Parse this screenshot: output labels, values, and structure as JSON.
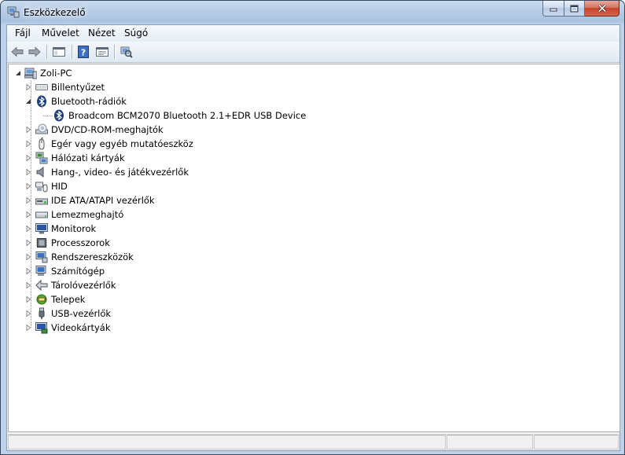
{
  "window": {
    "title": "Eszközkezelő",
    "icon": "device-manager-icon"
  },
  "menu": [
    {
      "label": "Fájl"
    },
    {
      "label": "Művelet"
    },
    {
      "label": "Nézet"
    },
    {
      "label": "Súgó"
    }
  ],
  "toolbar": [
    {
      "name": "back-icon"
    },
    {
      "name": "forward-icon"
    },
    {
      "name": "show-hide-console-tree-icon"
    },
    {
      "name": "help-icon"
    },
    {
      "name": "properties-icon"
    },
    {
      "name": "scan-hardware-icon"
    }
  ],
  "tree": {
    "root": {
      "label": "Zoli-PC",
      "icon": "computer-icon",
      "expanded": true
    },
    "nodes": [
      {
        "label": "Billentyűzet",
        "icon": "keyboard-icon",
        "expanded": false
      },
      {
        "label": "Bluetooth-rádiók",
        "icon": "bluetooth-icon",
        "expanded": true,
        "children": [
          {
            "label": "Broadcom BCM2070 Bluetooth 2.1+EDR USB Device",
            "icon": "bluetooth-device-icon"
          }
        ]
      },
      {
        "label": "DVD/CD-ROM-meghajtók",
        "icon": "dvd-drive-icon",
        "expanded": false
      },
      {
        "label": "Egér vagy egyéb mutatóeszköz",
        "icon": "mouse-icon",
        "expanded": false
      },
      {
        "label": "Hálózati kártyák",
        "icon": "network-adapter-icon",
        "expanded": false
      },
      {
        "label": "Hang-, video- és játékvezérlők",
        "icon": "sound-icon",
        "expanded": false
      },
      {
        "label": "HID",
        "icon": "hid-icon",
        "expanded": false
      },
      {
        "label": "IDE ATA/ATAPI vezérlők",
        "icon": "ide-controller-icon",
        "expanded": false
      },
      {
        "label": "Lemezmeghajtó",
        "icon": "disk-drive-icon",
        "expanded": false
      },
      {
        "label": "Monitorok",
        "icon": "monitor-icon",
        "expanded": false
      },
      {
        "label": "Processzorok",
        "icon": "processor-icon",
        "expanded": false
      },
      {
        "label": "Rendszereszközök",
        "icon": "system-devices-icon",
        "expanded": false
      },
      {
        "label": "Számítógép",
        "icon": "computer-category-icon",
        "expanded": false
      },
      {
        "label": "Tárolóvezérlők",
        "icon": "storage-controller-icon",
        "expanded": false
      },
      {
        "label": "Telepek",
        "icon": "battery-icon",
        "expanded": false
      },
      {
        "label": "USB-vezérlők",
        "icon": "usb-controller-icon",
        "expanded": false
      },
      {
        "label": "Videokártyák",
        "icon": "display-adapter-icon",
        "expanded": false
      }
    ]
  },
  "status": [
    "",
    "",
    ""
  ]
}
